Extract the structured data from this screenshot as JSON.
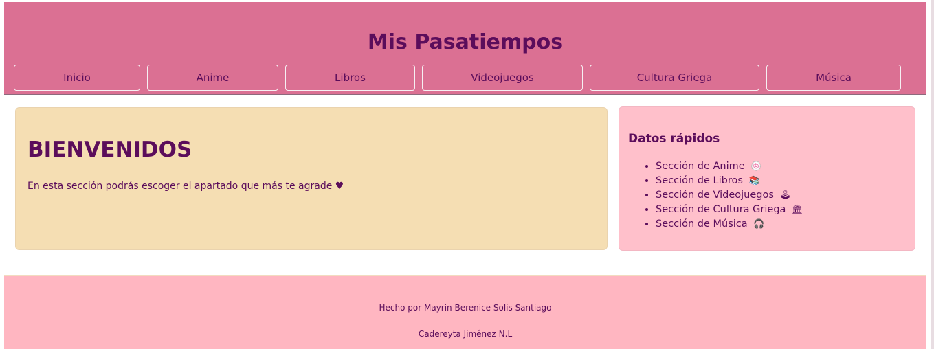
{
  "header": {
    "title": "Mis Pasatiempos",
    "nav": [
      {
        "label": "Inicio"
      },
      {
        "label": "Anime"
      },
      {
        "label": "Libros"
      },
      {
        "label": "Videojuegos"
      },
      {
        "label": "Cultura Griega"
      },
      {
        "label": "Música"
      }
    ]
  },
  "welcome": {
    "title": "BIENVENIDOS",
    "text": "En esta sección podrás escoger el apartado que más te agrade ♥"
  },
  "quick_facts": {
    "title": "Datos rápidos",
    "items": [
      {
        "label": "Sección de Anime",
        "icon": "🍥",
        "icon_name": "fish-cake-icon"
      },
      {
        "label": "Sección de Libros",
        "icon": "📚",
        "icon_name": "books-icon"
      },
      {
        "label": "Sección de Videojuegos",
        "icon": "🕹",
        "icon_name": "joystick-icon"
      },
      {
        "label": "Sección de Cultura Griega",
        "icon": "🏛",
        "icon_name": "classical-building-icon"
      },
      {
        "label": "Sección de Música",
        "icon": "🎧",
        "icon_name": "headphones-icon"
      }
    ]
  },
  "footer": {
    "line1": "Hecho por Mayrin Berenice Solis Santiago",
    "line2": "Cadereyta Jiménez N.L"
  },
  "colors": {
    "header_bg": "#db7093",
    "text": "#5b0d5b",
    "welcome_bg": "#f5deb3",
    "quick_bg": "#ffc0cb",
    "footer_bg": "#ffb6c1"
  }
}
